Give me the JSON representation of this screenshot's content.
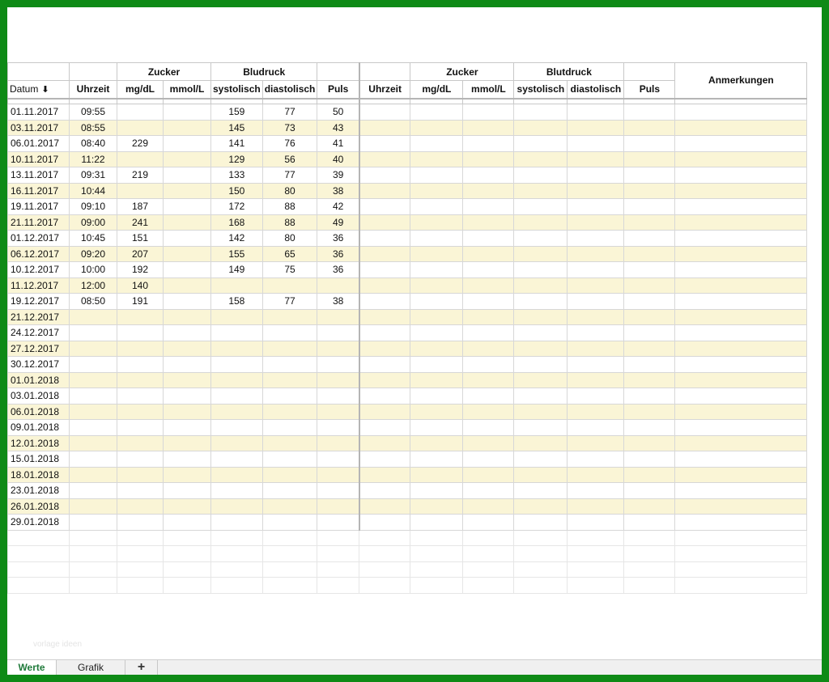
{
  "headers": {
    "group_zucker_left": "Zucker",
    "group_bludruck": "Bludruck",
    "group_zucker_right": "Zucker",
    "group_blutdruck": "Blutdruck",
    "anmerkungen": "Anmerkungen",
    "datum": "Datum",
    "uhrzeit": "Uhrzeit",
    "mgdl": "mg/dL",
    "mmoll": "mmol/L",
    "systolisch": "systolisch",
    "diastolisch": "diastolisch",
    "puls": "Puls",
    "sort_icon": "sort-descending-icon"
  },
  "rows": [
    {
      "datum": "01.11.2017",
      "uhrzeit": "09:55",
      "mgdl": "",
      "mmol": "",
      "sys": "159",
      "dia": "77",
      "puls": "50"
    },
    {
      "datum": "03.11.2017",
      "uhrzeit": "08:55",
      "mgdl": "",
      "mmol": "",
      "sys": "145",
      "dia": "73",
      "puls": "43"
    },
    {
      "datum": "06.01.2017",
      "uhrzeit": "08:40",
      "mgdl": "229",
      "mmol": "",
      "sys": "141",
      "dia": "76",
      "puls": "41"
    },
    {
      "datum": "10.11.2017",
      "uhrzeit": "11:22",
      "mgdl": "",
      "mmol": "",
      "sys": "129",
      "dia": "56",
      "puls": "40"
    },
    {
      "datum": "13.11.2017",
      "uhrzeit": "09:31",
      "mgdl": "219",
      "mmol": "",
      "sys": "133",
      "dia": "77",
      "puls": "39"
    },
    {
      "datum": "16.11.2017",
      "uhrzeit": "10:44",
      "mgdl": "",
      "mmol": "",
      "sys": "150",
      "dia": "80",
      "puls": "38"
    },
    {
      "datum": "19.11.2017",
      "uhrzeit": "09:10",
      "mgdl": "187",
      "mmol": "",
      "sys": "172",
      "dia": "88",
      "puls": "42"
    },
    {
      "datum": "21.11.2017",
      "uhrzeit": "09:00",
      "mgdl": "241",
      "mmol": "",
      "sys": "168",
      "dia": "88",
      "puls": "49"
    },
    {
      "datum": "01.12.2017",
      "uhrzeit": "10:45",
      "mgdl": "151",
      "mmol": "",
      "sys": "142",
      "dia": "80",
      "puls": "36"
    },
    {
      "datum": "06.12.2017",
      "uhrzeit": "09:20",
      "mgdl": "207",
      "mmol": "",
      "sys": "155",
      "dia": "65",
      "puls": "36"
    },
    {
      "datum": "10.12.2017",
      "uhrzeit": "10:00",
      "mgdl": "192",
      "mmol": "",
      "sys": "149",
      "dia": "75",
      "puls": "36"
    },
    {
      "datum": "11.12.2017",
      "uhrzeit": "12:00",
      "mgdl": "140",
      "mmol": "",
      "sys": "",
      "dia": "",
      "puls": ""
    },
    {
      "datum": "19.12.2017",
      "uhrzeit": "08:50",
      "mgdl": "191",
      "mmol": "",
      "sys": "158",
      "dia": "77",
      "puls": "38"
    },
    {
      "datum": "21.12.2017",
      "uhrzeit": "",
      "mgdl": "",
      "mmol": "",
      "sys": "",
      "dia": "",
      "puls": ""
    },
    {
      "datum": "24.12.2017",
      "uhrzeit": "",
      "mgdl": "",
      "mmol": "",
      "sys": "",
      "dia": "",
      "puls": ""
    },
    {
      "datum": "27.12.2017",
      "uhrzeit": "",
      "mgdl": "",
      "mmol": "",
      "sys": "",
      "dia": "",
      "puls": ""
    },
    {
      "datum": "30.12.2017",
      "uhrzeit": "",
      "mgdl": "",
      "mmol": "",
      "sys": "",
      "dia": "",
      "puls": ""
    },
    {
      "datum": "01.01.2018",
      "uhrzeit": "",
      "mgdl": "",
      "mmol": "",
      "sys": "",
      "dia": "",
      "puls": ""
    },
    {
      "datum": "03.01.2018",
      "uhrzeit": "",
      "mgdl": "",
      "mmol": "",
      "sys": "",
      "dia": "",
      "puls": ""
    },
    {
      "datum": "06.01.2018",
      "uhrzeit": "",
      "mgdl": "",
      "mmol": "",
      "sys": "",
      "dia": "",
      "puls": ""
    },
    {
      "datum": "09.01.2018",
      "uhrzeit": "",
      "mgdl": "",
      "mmol": "",
      "sys": "",
      "dia": "",
      "puls": ""
    },
    {
      "datum": "12.01.2018",
      "uhrzeit": "",
      "mgdl": "",
      "mmol": "",
      "sys": "",
      "dia": "",
      "puls": ""
    },
    {
      "datum": "15.01.2018",
      "uhrzeit": "",
      "mgdl": "",
      "mmol": "",
      "sys": "",
      "dia": "",
      "puls": ""
    },
    {
      "datum": "18.01.2018",
      "uhrzeit": "",
      "mgdl": "",
      "mmol": "",
      "sys": "",
      "dia": "",
      "puls": ""
    },
    {
      "datum": "23.01.2018",
      "uhrzeit": "",
      "mgdl": "",
      "mmol": "",
      "sys": "",
      "dia": "",
      "puls": ""
    },
    {
      "datum": "26.01.2018",
      "uhrzeit": "",
      "mgdl": "",
      "mmol": "",
      "sys": "",
      "dia": "",
      "puls": ""
    },
    {
      "datum": "29.01.2018",
      "uhrzeit": "",
      "mgdl": "",
      "mmol": "",
      "sys": "",
      "dia": "",
      "puls": ""
    }
  ],
  "watermark": "vorlage ideen",
  "tabs": {
    "werte": "Werte",
    "grafik": "Grafik",
    "add": "+"
  },
  "colors": {
    "frame": "#0e8a16",
    "alt_row": "#faf5d6",
    "active_tab": "#1f7a3a"
  }
}
